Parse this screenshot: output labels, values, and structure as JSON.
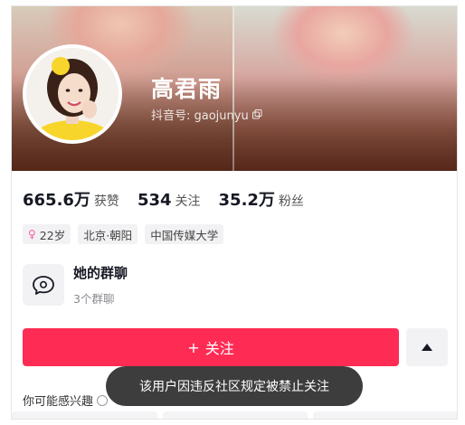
{
  "profile": {
    "nickname": "高君雨",
    "id_label": "抖音号: gaojunyu",
    "avatar_icon": "user-avatar-photo"
  },
  "stats": [
    {
      "value": "665.6万",
      "label": "获赞"
    },
    {
      "value": "534",
      "label": "关注"
    },
    {
      "value": "35.2万",
      "label": "粉丝"
    }
  ],
  "tags": [
    {
      "icon": "female-icon",
      "label": "22岁"
    },
    {
      "label": "北京·朝阳"
    },
    {
      "label": "中国传媒大学"
    }
  ],
  "group_chat": {
    "title": "她的群聊",
    "subtitle": "3个群聊",
    "icon": "chat-bubble-icon"
  },
  "actions": {
    "follow_label": "关注",
    "follow_prefix": "+",
    "more_icon": "caret-up-icon"
  },
  "interest": {
    "label": "你可能感兴趣"
  },
  "toast": {
    "message": "该用户因违反社区规定被禁止关注"
  },
  "colors": {
    "accent": "#fe2c55",
    "text": "#161823",
    "female": "#ff5aa0"
  }
}
